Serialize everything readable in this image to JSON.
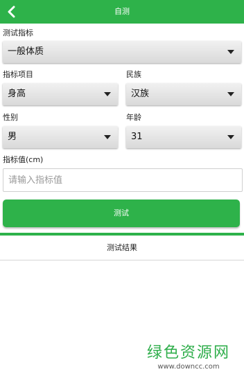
{
  "header": {
    "title": "自测",
    "back_icon": "chevron-left-icon"
  },
  "form": {
    "indicator": {
      "label": "测试指标",
      "value": "一般体质"
    },
    "item": {
      "label": "指标项目",
      "value": "身高"
    },
    "ethnicity": {
      "label": "民族",
      "value": "汉族"
    },
    "gender": {
      "label": "性别",
      "value": "男"
    },
    "age": {
      "label": "年龄",
      "value": "31"
    },
    "indicator_value": {
      "label": "指标值(cm)",
      "placeholder": "请输入指标值",
      "value": ""
    },
    "submit_label": "测试"
  },
  "results": {
    "tab_label": "测试结果"
  },
  "watermark": {
    "main": "绿色资源网",
    "sub": "www.downcc.com"
  },
  "colors": {
    "accent": "#2eb24a",
    "select_bg": "#e6e6e6"
  }
}
